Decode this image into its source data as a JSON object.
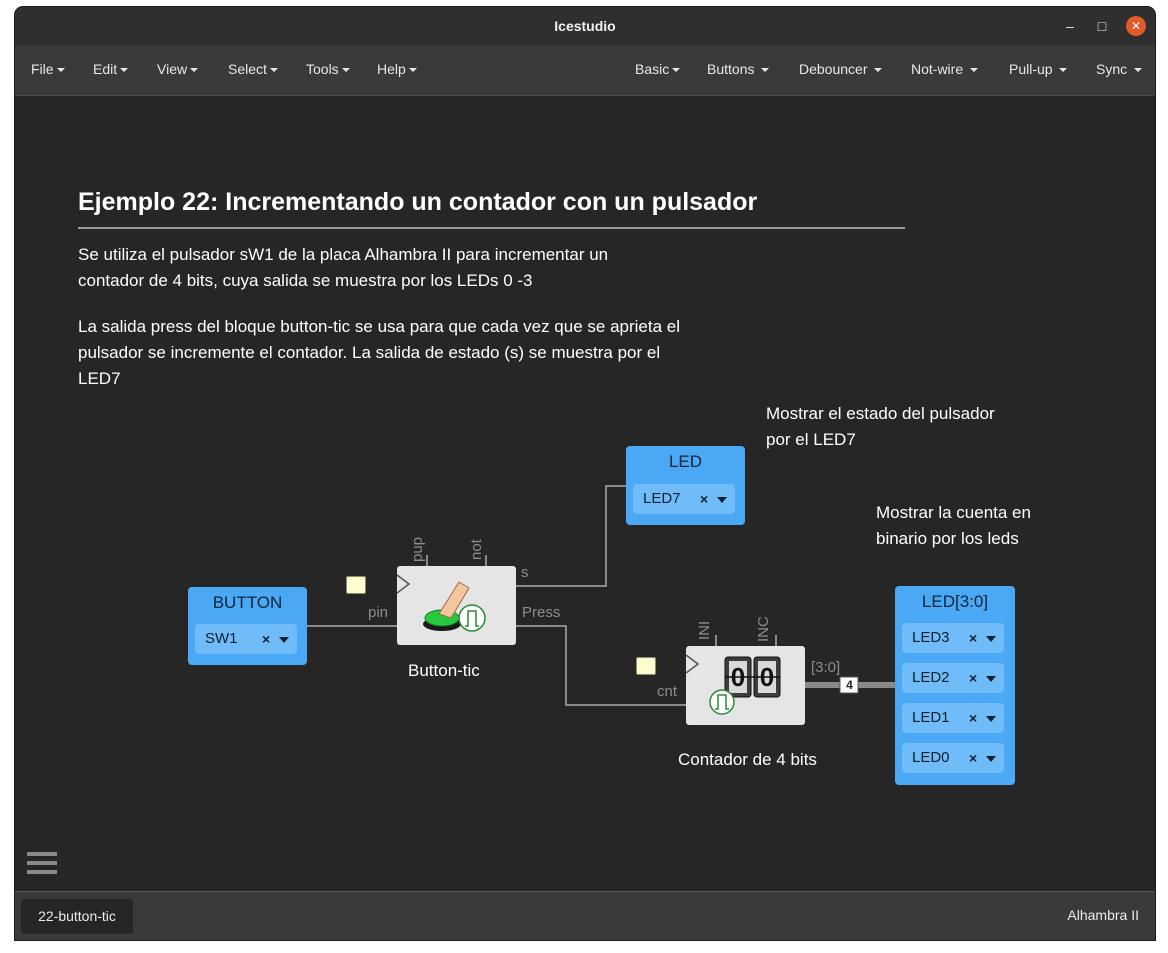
{
  "window": {
    "title": "Icestudio"
  },
  "menu": {
    "left": [
      "File",
      "Edit",
      "View",
      "Select",
      "Tools",
      "Help"
    ],
    "right": [
      "Basic",
      "Buttons",
      "Debouncer",
      "Not-wire",
      "Pull-up",
      "Sync"
    ]
  },
  "document": {
    "heading": "Ejemplo 22: Incrementando un contador con un pulsador",
    "paragraph1": [
      "Se utiliza el pulsador sW1 de la placa Alhambra II para incrementar un",
      "contador de 4 bits, cuya salida se muestra por los LEDs 0 -3"
    ],
    "paragraph2": [
      "La salida press del bloque button-tic se usa para que cada vez que se aprieta el",
      "pulsador se incremente el contador. La salida de estado (s) se muestra por el",
      "LED7"
    ]
  },
  "notes": {
    "led7": [
      "Mostrar el estado del pulsador",
      "por el LED7"
    ],
    "count": [
      "Mostrar la cuenta en",
      "binario por los leds"
    ]
  },
  "blocks": {
    "button": {
      "label": "BUTTON",
      "pin": "SW1"
    },
    "led": {
      "label": "LED",
      "pin": "LED7"
    },
    "leds": {
      "label": "LED[3:0]",
      "pins": [
        "LED3",
        "LED2",
        "LED1",
        "LED0"
      ]
    },
    "button_tic": {
      "title": "Button-tic",
      "pin_labels": {
        "pup": "pup",
        "not": "not",
        "s": "s",
        "press": "Press",
        "pin": "pin"
      }
    },
    "counter": {
      "title": "Contador de 4 bits",
      "digits": [
        "0",
        "0"
      ],
      "pin_labels": {
        "ini": "INI",
        "inc": "INC",
        "out": "[3:0]",
        "cnt": "cnt"
      },
      "bus_width": "4"
    }
  },
  "remove_glyph": "×",
  "statusbar": {
    "tab": "22-button-tic",
    "board": "Alhambra II"
  },
  "colors": {
    "io_block": "#4aa8f5",
    "io_pin": "#6fbcf8",
    "code_block": "#e5e5e5",
    "wire": "#8a8a8a",
    "close_button": "#e05a2a"
  }
}
